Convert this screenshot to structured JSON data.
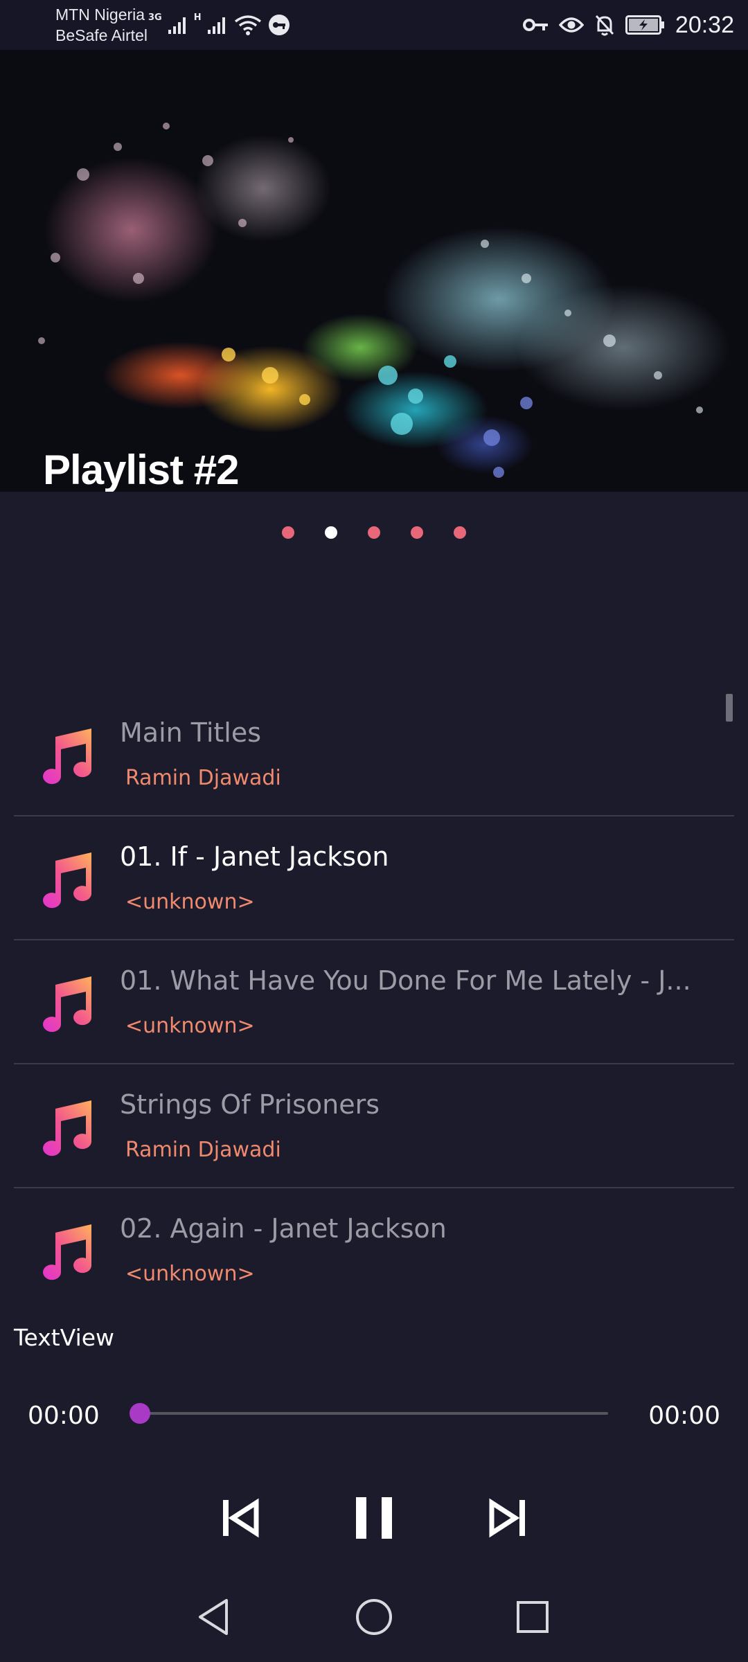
{
  "status_bar": {
    "carrier_1": "MTN Nigeria",
    "carrier_2": "BeSafe Airtel",
    "network_1": "3G",
    "network_2": "H",
    "time": "20:32",
    "icons_left": [
      "signal-3g-icon",
      "signal-h-icon",
      "wifi-icon",
      "vpn-icon"
    ],
    "icons_right": [
      "key-icon",
      "eye-icon",
      "bell-off-icon",
      "battery-charging-icon"
    ]
  },
  "banner": {
    "title": "Playlist #2",
    "page_count": 5,
    "active_page": 1
  },
  "tracks": [
    {
      "title": "Main Titles",
      "artist": "Ramin Djawadi",
      "current": false
    },
    {
      "title": "01. If - Janet Jackson",
      "artist": "<unknown>",
      "current": true
    },
    {
      "title": "01. What Have You Done For Me Lately - J...",
      "artist": "<unknown>",
      "current": false
    },
    {
      "title": "Strings Of Prisoners",
      "artist": "Ramin Djawadi",
      "current": false
    },
    {
      "title": "02. Again - Janet Jackson",
      "artist": "<unknown>",
      "current": false
    }
  ],
  "textview": "TextView",
  "player": {
    "elapsed": "00:00",
    "duration": "00:00",
    "progress": 0,
    "controls": [
      "skip-previous-icon",
      "pause-icon",
      "skip-next-icon"
    ]
  },
  "nav_bar": [
    "back-icon",
    "home-icon",
    "recents-icon"
  ],
  "colors": {
    "background": "#1b1b2b",
    "accent": "#a93ac6",
    "artist_text": "#f08a6e",
    "page_dot": "#e8687a",
    "music_gradient_start": "#f3309f",
    "music_gradient_end": "#ffb25c"
  }
}
